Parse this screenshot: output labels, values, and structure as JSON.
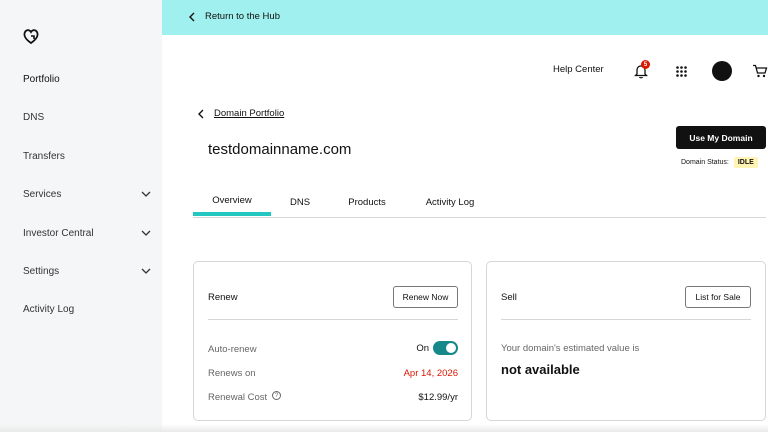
{
  "banner": {
    "back_label": "Return to the Hub",
    "color": "#9ff0ee"
  },
  "sidebar": {
    "items": [
      {
        "label": "Portfolio",
        "has_chevron": false
      },
      {
        "label": "DNS",
        "has_chevron": false
      },
      {
        "label": "Transfers",
        "has_chevron": false
      },
      {
        "label": "Services",
        "has_chevron": true
      },
      {
        "label": "Investor Central",
        "has_chevron": true
      },
      {
        "label": "Settings",
        "has_chevron": true
      },
      {
        "label": "Activity Log",
        "has_chevron": false
      }
    ]
  },
  "header": {
    "help_label": "Help Center",
    "notification_count": "5",
    "icons": [
      "bell-icon",
      "apps-grid-icon",
      "avatar",
      "cart-icon"
    ]
  },
  "breadcrumb": {
    "label": "Domain Portfolio"
  },
  "domain": {
    "name": "testdomainname.com",
    "use_button": "Use My Domain",
    "status_label": "Domain Status:",
    "status_value": "IDLE"
  },
  "tabs": [
    {
      "label": "Overview",
      "active": true
    },
    {
      "label": "DNS",
      "active": false
    },
    {
      "label": "Products",
      "active": false
    },
    {
      "label": "Activity Log",
      "active": false
    }
  ],
  "renew_card": {
    "title": "Renew",
    "button": "Renew Now",
    "auto_renew_label": "Auto-renew",
    "auto_renew_value": "On",
    "renews_on_label": "Renews on",
    "renews_on_value": "Apr 14, 2026",
    "renewal_cost_label": "Renewal Cost",
    "renewal_cost_value": "$12.99/yr",
    "date_color": "#db1802",
    "toggle_color": "#16888a"
  },
  "sell_card": {
    "title": "Sell",
    "button": "List for Sale",
    "estimate_label": "Your domain's estimated value is",
    "estimate_value": "not available"
  },
  "accent_color": "#22c7c0"
}
